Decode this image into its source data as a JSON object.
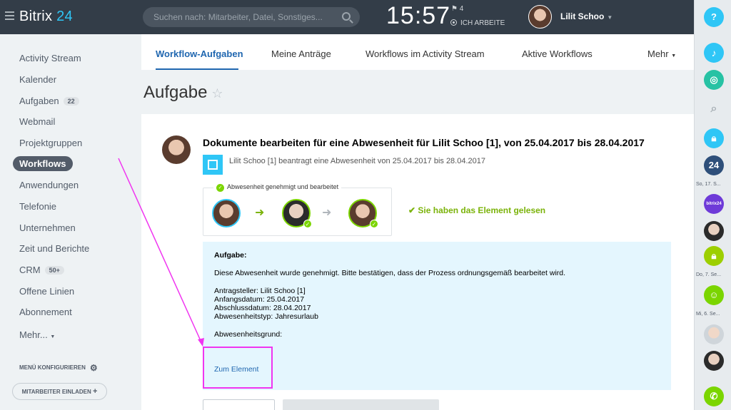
{
  "header": {
    "logo_text": "Bitrix",
    "logo_num": "24",
    "search_placeholder": "Suchen nach: Mitarbeiter, Datei, Sonstiges...",
    "time": "15:57",
    "flag_count": "4",
    "work_status": "ICH ARBEITE",
    "user_name": "Lilit Schoo"
  },
  "sidebar": {
    "items": [
      {
        "label": "Activity Stream"
      },
      {
        "label": "Kalender"
      },
      {
        "label": "Aufgaben",
        "badge": "22"
      },
      {
        "label": "Webmail"
      },
      {
        "label": "Projektgruppen"
      },
      {
        "label": "Workflows"
      },
      {
        "label": "Anwendungen"
      },
      {
        "label": "Telefonie"
      },
      {
        "label": "Unternehmen"
      },
      {
        "label": "Zeit und Berichte"
      },
      {
        "label": "CRM",
        "badge": "50+"
      },
      {
        "label": "Offene Linien"
      },
      {
        "label": "Abonnement"
      },
      {
        "label": "Mehr..."
      }
    ],
    "configure_label": "MENÜ KONFIGURIEREN",
    "invite_label": "MITARBEITER EINLADEN"
  },
  "tabs": [
    {
      "label": "Workflow-Aufgaben"
    },
    {
      "label": "Meine Anträge"
    },
    {
      "label": "Workflows im Activity Stream"
    },
    {
      "label": "Aktive Workflows"
    },
    {
      "label": "Mehr"
    }
  ],
  "page": {
    "title": "Aufgabe"
  },
  "task": {
    "title": "Dokumente bearbeiten für eine Abwesenheit für Lilit Schoo [1], von 25.04.2017 bis 28.04.2017",
    "request_text": "Lilit Schoo [1] beantragt eine Abwesenheit von 25.04.2017 bis 28.04.2017",
    "status_label": "Abwesenheit genehmigt und bearbeitet",
    "read_note": "Sie haben das Element gelesen",
    "info": {
      "heading": "Aufgabe:",
      "description": "Diese Abwesenheit wurde genehmigt. Bitte bestätigen, dass der Prozess ordnungsgemäß bearbeitet wird.",
      "requester": "Antragsteller: Lilit Schoo [1]",
      "start": "Anfangsdatum: 25.04.2017",
      "end": "Abschlussdatum: 28.04.2017",
      "type": "Abwesenheitstyp: Jahresurlaub",
      "reason": "Abwesenheitsgrund:",
      "link": "Zum Element"
    }
  },
  "rightbar": {
    "labels": [
      "So, 17. S...",
      "Do, 7. Se...",
      "Mi, 6. Se..."
    ]
  },
  "colors": {
    "header_bg": "#333d48",
    "accent": "#2067b0",
    "success": "#7bd500",
    "info_bg": "#e4f6fe",
    "highlight": "#f035f0"
  }
}
